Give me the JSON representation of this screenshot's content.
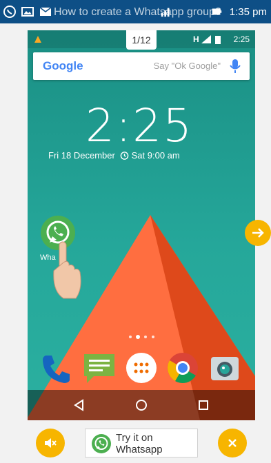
{
  "outer_status": {
    "title": "How to create a Whatsapp group?",
    "time": "1:35 pm"
  },
  "slide": {
    "counter": "1/12",
    "inner_status_time": "2:25",
    "inner_network": "H",
    "search_logo": "Google",
    "search_hint": "Say \"Ok Google\"",
    "clock": "2:25",
    "date": "Fri 18 December",
    "alarm": "Sat 9:00 am",
    "whatsapp_label": "Wha"
  },
  "bottom": {
    "try_label_line1": "Try it on",
    "try_label_line2": "Whatsapp"
  },
  "colors": {
    "outer_status_bg": "#0e4f86",
    "accent": "#f7b500",
    "teal": "#25a79a",
    "pyramid": "#e8582b"
  },
  "icons": [
    "whatsapp-icon",
    "gallery-icon",
    "mail-icon",
    "wifi-icon",
    "signal-icon",
    "battery-icon",
    "mic-icon",
    "phone-icon",
    "messages-icon",
    "apps-icon",
    "chrome-icon",
    "camera-icon",
    "back-icon",
    "home-icon",
    "recents-icon",
    "arrow-right-icon",
    "mute-icon",
    "close-icon"
  ]
}
